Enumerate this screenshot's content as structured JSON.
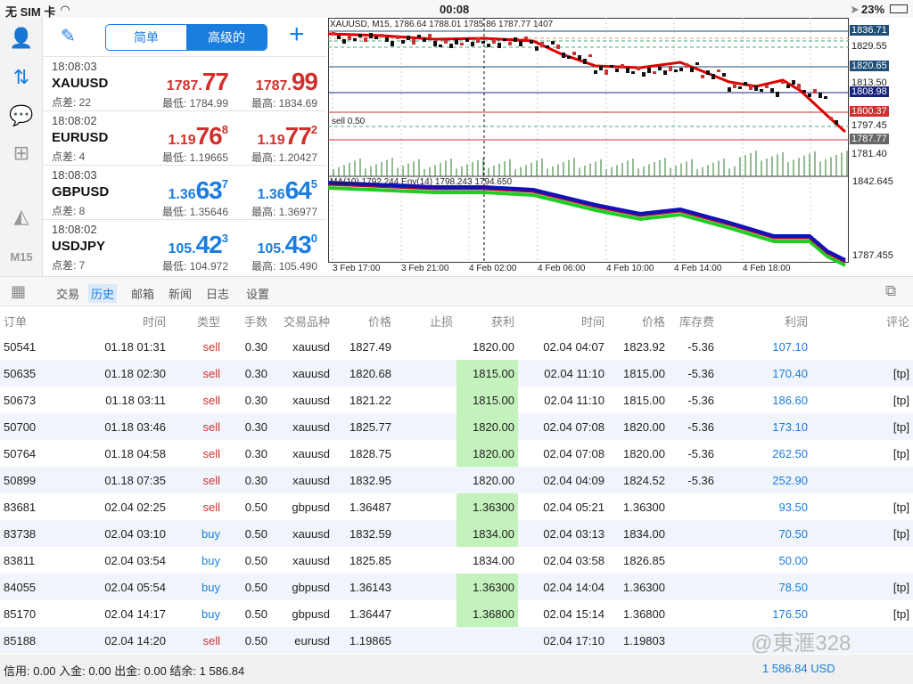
{
  "status": {
    "carrier": "无 SIM 卡",
    "time": "00:08",
    "battery": "23%"
  },
  "sidebar": {
    "timeframe": "M15"
  },
  "quotes": {
    "mode_tabs": [
      "简单",
      "高级的"
    ],
    "add_label": "+",
    "items": [
      {
        "time": "18:08:03",
        "symbol": "XAUUSD",
        "spread": "点差: 22",
        "bid": {
          "pre": "1787.",
          "big": "77",
          "sup": ""
        },
        "ask": {
          "pre": "1787.",
          "big": "99",
          "sup": ""
        },
        "low": "最低: 1784.99",
        "high": "最高: 1834.69",
        "color": "#d0312d"
      },
      {
        "time": "18:08:02",
        "symbol": "EURUSD",
        "spread": "点差: 4",
        "bid": {
          "pre": "1.19",
          "big": "76",
          "sup": "8"
        },
        "ask": {
          "pre": "1.19",
          "big": "77",
          "sup": "2"
        },
        "low": "最低: 1.19665",
        "high": "最高: 1.20427",
        "color": "#d0312d"
      },
      {
        "time": "18:08:03",
        "symbol": "GBPUSD",
        "spread": "点差: 8",
        "bid": {
          "pre": "1.36",
          "big": "63",
          "sup": "7"
        },
        "ask": {
          "pre": "1.36",
          "big": "64",
          "sup": "5"
        },
        "low": "最低: 1.35646",
        "high": "最高: 1.36977",
        "color": "#1a7ee0"
      },
      {
        "time": "18:08:02",
        "symbol": "USDJPY",
        "spread": "点差: 7",
        "bid": {
          "pre": "105.",
          "big": "42",
          "sup": "3"
        },
        "ask": {
          "pre": "105.",
          "big": "43",
          "sup": "0"
        },
        "low": "最低: 104.972",
        "high": "最高: 105.490",
        "color": "#1a7ee0"
      }
    ]
  },
  "chart": {
    "header": "XAUUSD, M15, 1786.64 1788.01 1785.86 1787.77 1407",
    "order_label": "sell 0.50",
    "indicator_header": "MA(10) 1792.244 Env(14) 1798.243 1794.650",
    "price_labels": [
      {
        "text": "1836.71",
        "style": "box",
        "color": "#1f4e79"
      },
      {
        "text": "1829.55",
        "style": "plain"
      },
      {
        "text": "1820.65",
        "style": "box",
        "color": "#1f4e79"
      },
      {
        "text": "1813.50",
        "style": "plain"
      },
      {
        "text": "1808.98",
        "style": "box",
        "color": "#1a237e"
      },
      {
        "text": "1800.37",
        "style": "box",
        "color": "#d32f2f"
      },
      {
        "text": "1797.45",
        "style": "plain"
      },
      {
        "text": "1787.77",
        "style": "box",
        "color": "#666666"
      },
      {
        "text": "1781.40",
        "style": "plain"
      }
    ],
    "indicator_labels": [
      "1842.645",
      "1787.455"
    ],
    "time_labels": [
      "3 Feb 17:00",
      "3 Feb 21:00",
      "4 Feb 02:00",
      "4 Feb 06:00",
      "4 Feb 10:00",
      "4 Feb 14:00",
      "4 Feb 18:00"
    ]
  },
  "tabs": {
    "items": [
      "交易",
      "历史",
      "邮箱",
      "新闻",
      "日志",
      "设置"
    ],
    "active": 1
  },
  "table": {
    "headers": [
      "订单",
      "时间",
      "类型",
      "手数",
      "交易品种",
      "价格",
      "止损",
      "获利",
      "时间",
      "价格",
      "库存费",
      "利润",
      "评论"
    ],
    "rows": [
      [
        "50541",
        "01.18 01:31",
        "sell",
        "0.30",
        "xauusd",
        "1827.49",
        "",
        "1820.00",
        "02.04 04:07",
        "1823.92",
        "-5.36",
        "107.10",
        ""
      ],
      [
        "50635",
        "01.18 02:30",
        "sell",
        "0.30",
        "xauusd",
        "1820.68",
        "",
        "1815.00",
        "02.04 11:10",
        "1815.00",
        "-5.36",
        "170.40",
        "[tp]"
      ],
      [
        "50673",
        "01.18 03:11",
        "sell",
        "0.30",
        "xauusd",
        "1821.22",
        "",
        "1815.00",
        "02.04 11:10",
        "1815.00",
        "-5.36",
        "186.60",
        "[tp]"
      ],
      [
        "50700",
        "01.18 03:46",
        "sell",
        "0.30",
        "xauusd",
        "1825.77",
        "",
        "1820.00",
        "02.04 07:08",
        "1820.00",
        "-5.36",
        "173.10",
        "[tp]"
      ],
      [
        "50764",
        "01.18 04:58",
        "sell",
        "0.30",
        "xauusd",
        "1828.75",
        "",
        "1820.00",
        "02.04 07:08",
        "1820.00",
        "-5.36",
        "262.50",
        "[tp]"
      ],
      [
        "50899",
        "01.18 07:35",
        "sell",
        "0.30",
        "xauusd",
        "1832.95",
        "",
        "1820.00",
        "02.04 04:09",
        "1824.52",
        "-5.36",
        "252.90",
        ""
      ],
      [
        "83681",
        "02.04 02:25",
        "sell",
        "0.50",
        "gbpusd",
        "1.36487",
        "",
        "1.36300",
        "02.04 05:21",
        "1.36300",
        "",
        "93.50",
        "[tp]"
      ],
      [
        "83738",
        "02.04 03:10",
        "buy",
        "0.50",
        "xauusd",
        "1832.59",
        "",
        "1834.00",
        "02.04 03:13",
        "1834.00",
        "",
        "70.50",
        "[tp]"
      ],
      [
        "83811",
        "02.04 03:54",
        "buy",
        "0.50",
        "xauusd",
        "1825.85",
        "",
        "1834.00",
        "02.04 03:58",
        "1826.85",
        "",
        "50.00",
        ""
      ],
      [
        "84055",
        "02.04 05:54",
        "buy",
        "0.50",
        "gbpusd",
        "1.36143",
        "",
        "1.36300",
        "02.04 14:04",
        "1.36300",
        "",
        "78.50",
        "[tp]"
      ],
      [
        "85170",
        "02.04 14:17",
        "buy",
        "0.50",
        "gbpusd",
        "1.36447",
        "",
        "1.36800",
        "02.04 15:14",
        "1.36800",
        "",
        "176.50",
        "[tp]"
      ],
      [
        "85188",
        "02.04 14:20",
        "sell",
        "0.50",
        "eurusd",
        "1.19865",
        "",
        "",
        "02.04 17:10",
        "1.19803",
        "",
        "",
        ""
      ]
    ]
  },
  "footer": {
    "summary": "信用:  0.00 入金:  0.00 出金:  0.00 结余:  1 586.84",
    "balance": "1 586.84  USD"
  },
  "watermark": "@東滙328",
  "colors": {
    "accent": "#1a7ee0",
    "sell": "#d0312d",
    "tp_highlight": "#c4f2bc"
  }
}
